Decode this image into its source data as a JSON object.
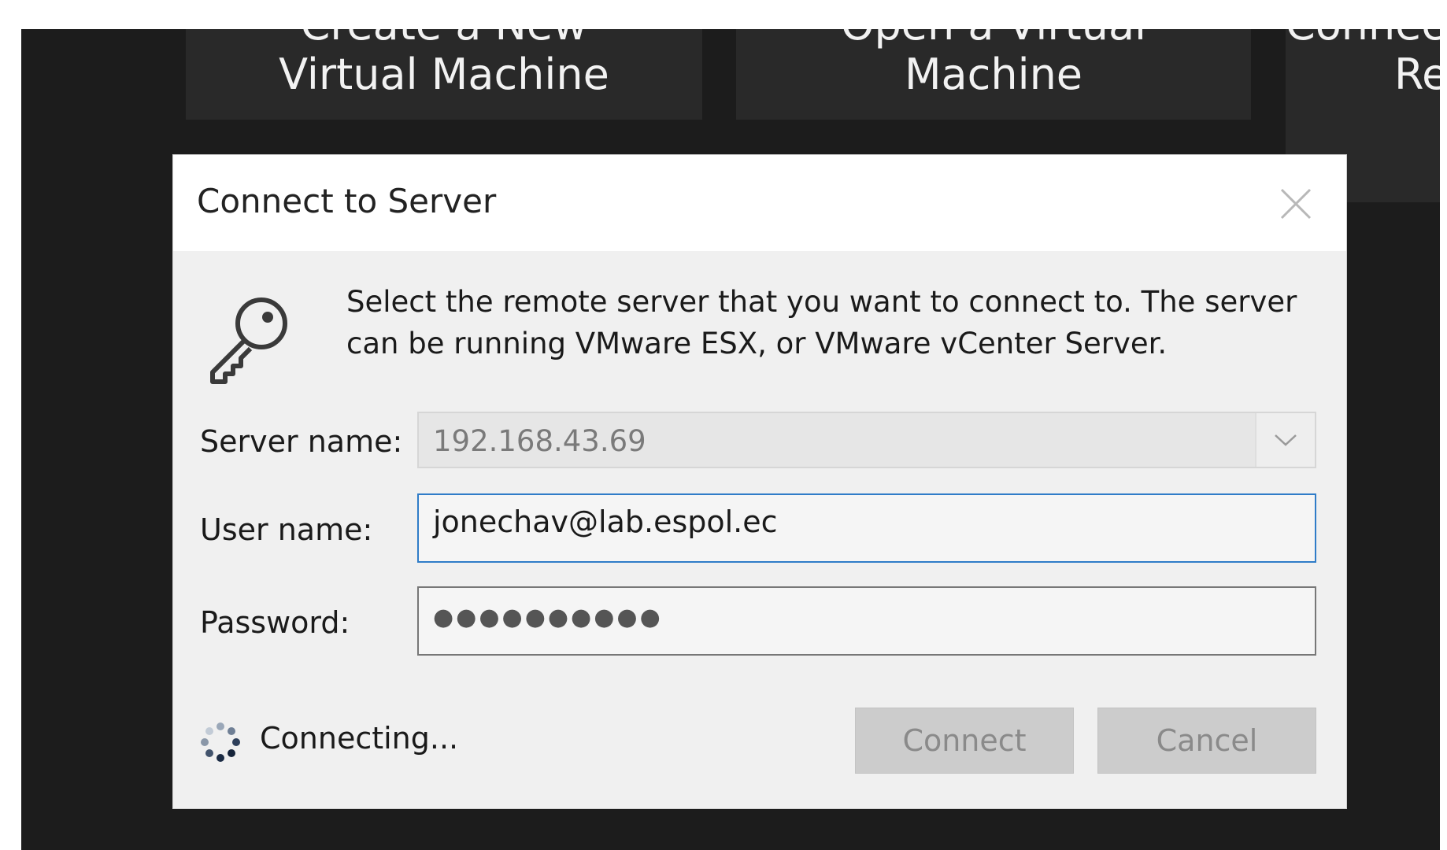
{
  "background_tiles": [
    {
      "line1": "Create a New",
      "line2": "Virtual Machine"
    },
    {
      "line1": "Open a Virtual",
      "line2": "Machine"
    },
    {
      "line1": "Connect to a",
      "line2": "Re"
    }
  ],
  "dialog": {
    "title": "Connect to Server",
    "close_icon": "close-icon",
    "key_icon": "key-icon",
    "message": "Select the remote server that you want to connect to. The server can be running VMware ESX, or VMware vCenter Server.",
    "server_label": "Server name:",
    "server_value": "192.168.43.69",
    "server_dropdown_icon": "chevron-down-icon",
    "user_label": "User name:",
    "user_value": "jonechav@lab.espol.ec",
    "password_label": "Password:",
    "password_mask": "●●●●●●●●●●",
    "status_icon": "spinner-icon",
    "status_text": "Connecting...",
    "connect_label": "Connect",
    "cancel_label": "Cancel"
  },
  "colors": {
    "backdrop": "#1c1c1c",
    "tile": "#292929",
    "dialog_bg": "#f0f0f0",
    "titlebar_bg": "#ffffff",
    "focus_border": "#2f7cc8",
    "disabled_button": "#cccccc"
  }
}
